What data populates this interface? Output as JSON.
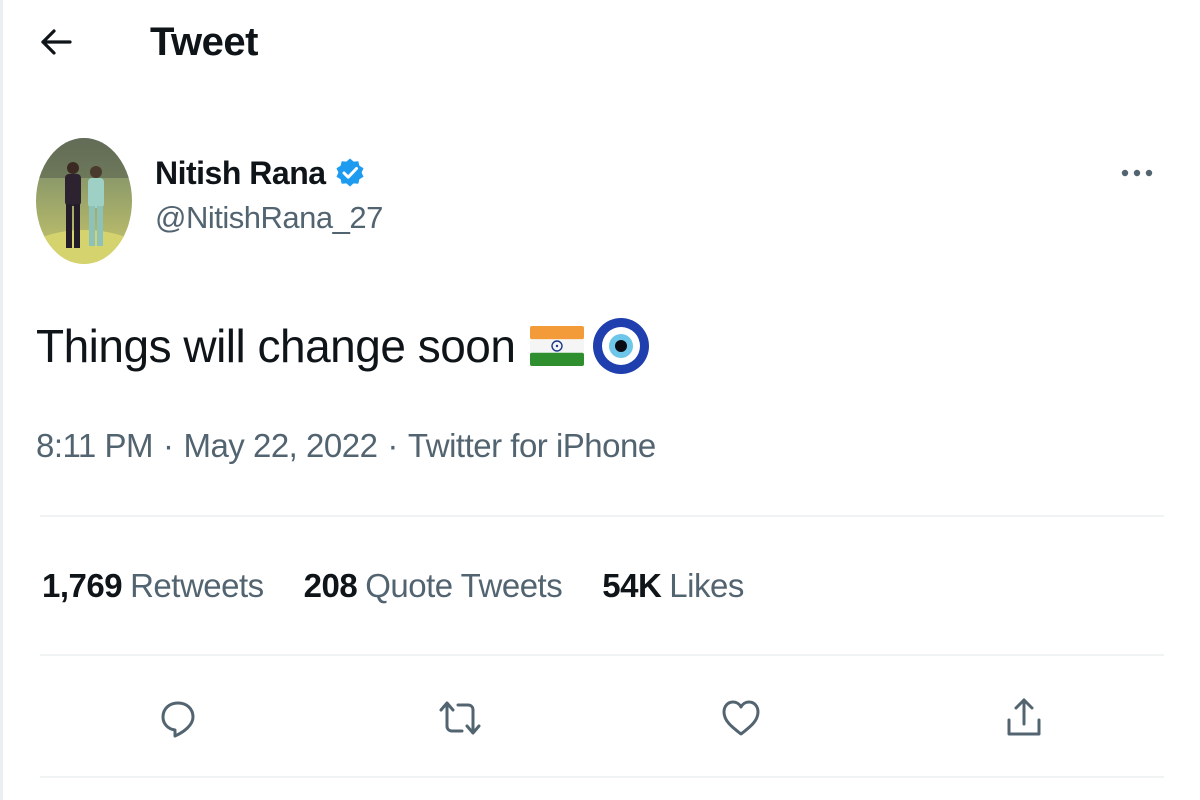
{
  "header": {
    "title": "Tweet",
    "back_icon": "arrow-left-icon"
  },
  "author": {
    "display_name": "Nitish Rana",
    "handle": "@NitishRana_27",
    "verified": true,
    "verified_color": "#1d9bf0"
  },
  "tweet": {
    "text": "Things will change soon",
    "emojis": [
      "india-flag-emoji",
      "nazar-amulet-emoji"
    ],
    "time": "8:11 PM",
    "date": "May 22, 2022",
    "source": "Twitter for iPhone",
    "separator": "·"
  },
  "stats": {
    "retweets_count": "1,769",
    "retweets_label": "Retweets",
    "quote_tweets_count": "208",
    "quote_tweets_label": "Quote Tweets",
    "likes_count": "54K",
    "likes_label": "Likes"
  },
  "actions": [
    "reply-icon",
    "retweet-icon",
    "like-icon",
    "share-icon"
  ],
  "colors": {
    "text_primary": "#0f1419",
    "text_secondary": "#536471",
    "divider": "#eff3f4"
  }
}
